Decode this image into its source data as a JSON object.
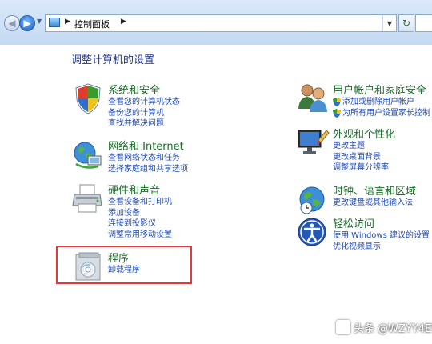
{
  "address_bar": {
    "breadcrumb": "控制面板"
  },
  "page": {
    "title": "调整计算机的设置"
  },
  "categories": [
    {
      "title": "系统和安全",
      "icon": "security-shield-icon",
      "links": [
        "查看您的计算机状态",
        "备份您的计算机",
        "查找并解决问题"
      ]
    },
    {
      "title": "网络和 Internet",
      "icon": "network-globe-icon",
      "links": [
        "查看网络状态和任务",
        "选择家庭组和共享选项"
      ]
    },
    {
      "title": "硬件和声音",
      "icon": "printer-icon",
      "links": [
        "查看设备和打印机",
        "添加设备",
        "连接到投影仪",
        "调整常用移动设置"
      ]
    },
    {
      "title": "程序",
      "icon": "programs-icon",
      "links": [
        "卸载程序"
      ]
    },
    {
      "title": "用户帐户和家庭安全",
      "icon": "users-icon",
      "links": [
        "添加或删除用户帐户",
        "为所有用户设置家长控制"
      ]
    },
    {
      "title": "外观和个性化",
      "icon": "appearance-monitor-icon",
      "links": [
        "更改主题",
        "更改桌面背景",
        "调整屏幕分辨率"
      ]
    },
    {
      "title": "时钟、语言和区域",
      "icon": "clock-globe-icon",
      "links": [
        "更改键盘或其他输入法"
      ]
    },
    {
      "title": "轻松访问",
      "icon": "ease-of-access-icon",
      "links": [
        "使用 Windows 建议的设置",
        "优化视频显示"
      ]
    }
  ],
  "watermark": {
    "text": "头条 @WZYY4EVER"
  },
  "colors": {
    "category_title": "#1d6b2a",
    "link": "#1f4ab0",
    "page_title": "#1e3287",
    "highlight": "#e23a3a"
  }
}
